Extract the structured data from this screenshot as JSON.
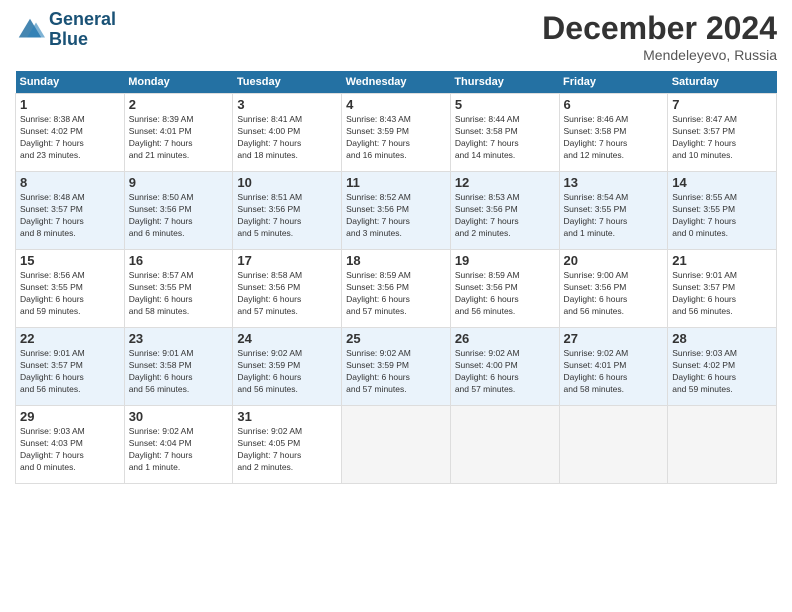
{
  "header": {
    "logo_line1": "General",
    "logo_line2": "Blue",
    "month": "December 2024",
    "location": "Mendeleyevo, Russia"
  },
  "days_of_week": [
    "Sunday",
    "Monday",
    "Tuesday",
    "Wednesday",
    "Thursday",
    "Friday",
    "Saturday"
  ],
  "weeks": [
    {
      "bg": "white",
      "days": [
        {
          "num": "1",
          "info": "Sunrise: 8:38 AM\nSunset: 4:02 PM\nDaylight: 7 hours\nand 23 minutes."
        },
        {
          "num": "2",
          "info": "Sunrise: 8:39 AM\nSunset: 4:01 PM\nDaylight: 7 hours\nand 21 minutes."
        },
        {
          "num": "3",
          "info": "Sunrise: 8:41 AM\nSunset: 4:00 PM\nDaylight: 7 hours\nand 18 minutes."
        },
        {
          "num": "4",
          "info": "Sunrise: 8:43 AM\nSunset: 3:59 PM\nDaylight: 7 hours\nand 16 minutes."
        },
        {
          "num": "5",
          "info": "Sunrise: 8:44 AM\nSunset: 3:58 PM\nDaylight: 7 hours\nand 14 minutes."
        },
        {
          "num": "6",
          "info": "Sunrise: 8:46 AM\nSunset: 3:58 PM\nDaylight: 7 hours\nand 12 minutes."
        },
        {
          "num": "7",
          "info": "Sunrise: 8:47 AM\nSunset: 3:57 PM\nDaylight: 7 hours\nand 10 minutes."
        }
      ]
    },
    {
      "bg": "alt",
      "days": [
        {
          "num": "8",
          "info": "Sunrise: 8:48 AM\nSunset: 3:57 PM\nDaylight: 7 hours\nand 8 minutes."
        },
        {
          "num": "9",
          "info": "Sunrise: 8:50 AM\nSunset: 3:56 PM\nDaylight: 7 hours\nand 6 minutes."
        },
        {
          "num": "10",
          "info": "Sunrise: 8:51 AM\nSunset: 3:56 PM\nDaylight: 7 hours\nand 5 minutes."
        },
        {
          "num": "11",
          "info": "Sunrise: 8:52 AM\nSunset: 3:56 PM\nDaylight: 7 hours\nand 3 minutes."
        },
        {
          "num": "12",
          "info": "Sunrise: 8:53 AM\nSunset: 3:56 PM\nDaylight: 7 hours\nand 2 minutes."
        },
        {
          "num": "13",
          "info": "Sunrise: 8:54 AM\nSunset: 3:55 PM\nDaylight: 7 hours\nand 1 minute."
        },
        {
          "num": "14",
          "info": "Sunrise: 8:55 AM\nSunset: 3:55 PM\nDaylight: 7 hours\nand 0 minutes."
        }
      ]
    },
    {
      "bg": "white",
      "days": [
        {
          "num": "15",
          "info": "Sunrise: 8:56 AM\nSunset: 3:55 PM\nDaylight: 6 hours\nand 59 minutes."
        },
        {
          "num": "16",
          "info": "Sunrise: 8:57 AM\nSunset: 3:55 PM\nDaylight: 6 hours\nand 58 minutes."
        },
        {
          "num": "17",
          "info": "Sunrise: 8:58 AM\nSunset: 3:56 PM\nDaylight: 6 hours\nand 57 minutes."
        },
        {
          "num": "18",
          "info": "Sunrise: 8:59 AM\nSunset: 3:56 PM\nDaylight: 6 hours\nand 57 minutes."
        },
        {
          "num": "19",
          "info": "Sunrise: 8:59 AM\nSunset: 3:56 PM\nDaylight: 6 hours\nand 56 minutes."
        },
        {
          "num": "20",
          "info": "Sunrise: 9:00 AM\nSunset: 3:56 PM\nDaylight: 6 hours\nand 56 minutes."
        },
        {
          "num": "21",
          "info": "Sunrise: 9:01 AM\nSunset: 3:57 PM\nDaylight: 6 hours\nand 56 minutes."
        }
      ]
    },
    {
      "bg": "alt",
      "days": [
        {
          "num": "22",
          "info": "Sunrise: 9:01 AM\nSunset: 3:57 PM\nDaylight: 6 hours\nand 56 minutes."
        },
        {
          "num": "23",
          "info": "Sunrise: 9:01 AM\nSunset: 3:58 PM\nDaylight: 6 hours\nand 56 minutes."
        },
        {
          "num": "24",
          "info": "Sunrise: 9:02 AM\nSunset: 3:59 PM\nDaylight: 6 hours\nand 56 minutes."
        },
        {
          "num": "25",
          "info": "Sunrise: 9:02 AM\nSunset: 3:59 PM\nDaylight: 6 hours\nand 57 minutes."
        },
        {
          "num": "26",
          "info": "Sunrise: 9:02 AM\nSunset: 4:00 PM\nDaylight: 6 hours\nand 57 minutes."
        },
        {
          "num": "27",
          "info": "Sunrise: 9:02 AM\nSunset: 4:01 PM\nDaylight: 6 hours\nand 58 minutes."
        },
        {
          "num": "28",
          "info": "Sunrise: 9:03 AM\nSunset: 4:02 PM\nDaylight: 6 hours\nand 59 minutes."
        }
      ]
    },
    {
      "bg": "white",
      "days": [
        {
          "num": "29",
          "info": "Sunrise: 9:03 AM\nSunset: 4:03 PM\nDaylight: 7 hours\nand 0 minutes."
        },
        {
          "num": "30",
          "info": "Sunrise: 9:02 AM\nSunset: 4:04 PM\nDaylight: 7 hours\nand 1 minute."
        },
        {
          "num": "31",
          "info": "Sunrise: 9:02 AM\nSunset: 4:05 PM\nDaylight: 7 hours\nand 2 minutes."
        },
        {
          "num": "",
          "info": ""
        },
        {
          "num": "",
          "info": ""
        },
        {
          "num": "",
          "info": ""
        },
        {
          "num": "",
          "info": ""
        }
      ]
    }
  ]
}
